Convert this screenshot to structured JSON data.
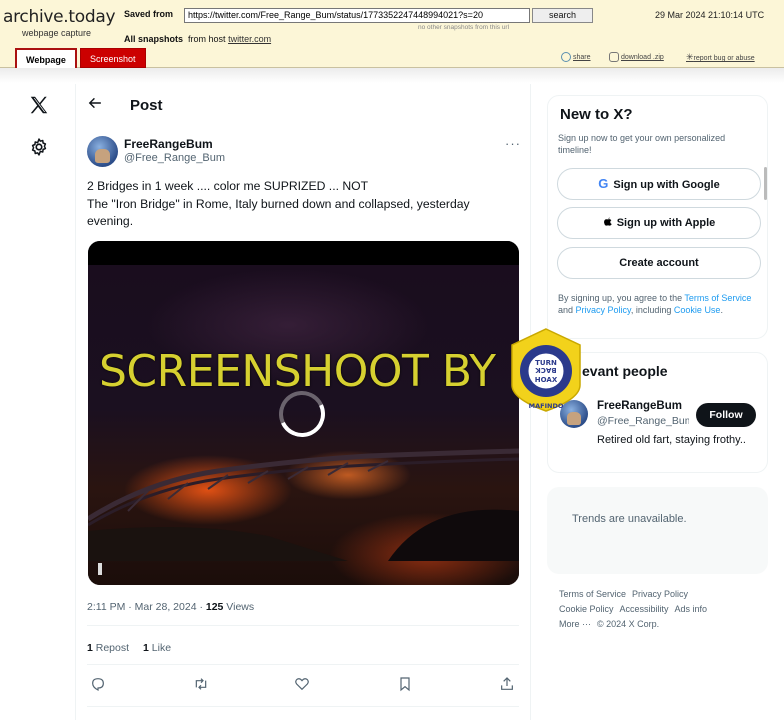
{
  "archive": {
    "logo": "archive.today",
    "logo_sub": "webpage capture",
    "saved_from_label": "Saved from",
    "url": "https://twitter.com/Free_Range_Bum/status/1773352247448994021?s=20",
    "search_label": "search",
    "other_snapshots": "no other snapshots from this url",
    "datetime": "29 Mar 2024 21:10:14 UTC",
    "all_snapshots_label": "All snapshots",
    "from_host_label": "from host",
    "host": "twitter.com",
    "tabs": [
      "Webpage",
      "Screenshot"
    ],
    "tools": [
      "share",
      "download .zip",
      "report bug or abuse"
    ]
  },
  "header": {
    "title": "Post"
  },
  "tweet": {
    "display_name": "FreeRangeBum",
    "handle": "@Free_Range_Bum",
    "text_line1": "2 Bridges in 1 week .... color me SUPRIZED ... NOT",
    "text_line2": "The \"Iron Bridge\" in Rome, Italy burned down and collapsed, yesterday evening.",
    "video_watermark": "SCREENSHOOT BY",
    "timestamp": "2:11 PM · Mar 28, 2024 · ",
    "views_count": "125",
    "views_label": " Views",
    "reposts_count": "1",
    "reposts_label": " Repost",
    "likes_count": "1",
    "likes_label": " Like",
    "actions": [
      "reply-icon",
      "repost-icon",
      "like-icon",
      "bookmark-icon",
      "share-icon"
    ]
  },
  "sidebar": {
    "new_to_x": {
      "title": "New to X?",
      "subtitle": "Sign up now to get your own personalized timeline!",
      "google_label": "Sign up with Google",
      "apple_label": "Sign up with Apple",
      "create_label": "Create account",
      "legal_prefix": "By signing up, you agree to the ",
      "terms_link": "Terms of Service",
      "legal_and": " and ",
      "privacy_link": "Privacy Policy",
      "legal_including": ", including ",
      "cookie_link": "Cookie Use",
      "legal_end": "."
    },
    "relevant": {
      "title": "Relevant people",
      "title_visible": "evant people",
      "name": "FreeRangeBum",
      "handle": "@Free_Range_Bum",
      "follow_label": "Follow",
      "bio": "Retired old fart, staying frothy.."
    },
    "trends": {
      "message": "Trends are unavailable."
    },
    "footer": [
      "Terms of Service",
      "Privacy Policy",
      "Cookie Policy",
      "Accessibility",
      "Ads info",
      "More ···",
      "© 2024 X Corp."
    ]
  },
  "badge": {
    "line1": "TURN",
    "line2": "BACK",
    "line3": "HOAX",
    "ring_top": "MASYARAKAT ANTI FITNAH INDONESIA",
    "ring_bottom": "MAFINDO"
  },
  "colors": {
    "archive_bg": "#fcf6d7",
    "archive_red": "#cc0000",
    "x_blue": "#1d9bf0",
    "watermark_yellow": "#d6d030",
    "badge_yellow": "#f2d21b",
    "badge_blue": "#2b3a8c"
  }
}
